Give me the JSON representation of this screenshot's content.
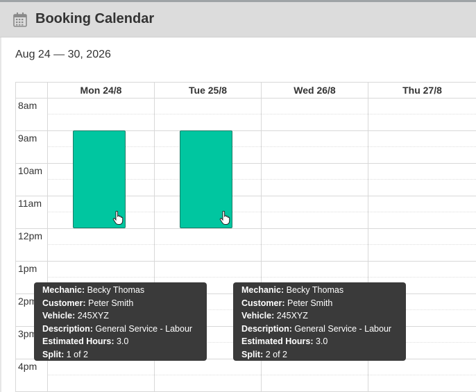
{
  "header": {
    "title": "Booking Calendar",
    "icon": "calendar-icon"
  },
  "date_range": "Aug 24 — 30, 2026",
  "days": [
    "Mon 24/8",
    "Tue 25/8",
    "Wed 26/8",
    "Thu 27/8"
  ],
  "times": [
    "8am",
    "9am",
    "10am",
    "11am",
    "12pm",
    "1pm",
    "2pm",
    "3pm",
    "4pm"
  ],
  "colors": {
    "event": "#00c6a0",
    "tooltip_bg": "#3a3a3a",
    "header_bg": "#dcdcdc"
  },
  "events": [
    {
      "day": "Mon 24/8",
      "start": "9am",
      "end": "12pm"
    },
    {
      "day": "Tue 25/8",
      "start": "9am",
      "end": "12pm"
    }
  ],
  "tooltips": [
    {
      "labels": {
        "mechanic": "Mechanic:",
        "customer": "Customer:",
        "vehicle": "Vehicle:",
        "description": "Description:",
        "hours": "Estimated Hours:",
        "split": "Split:"
      },
      "mechanic": "Becky Thomas",
      "customer": "Peter Smith",
      "vehicle": "245XYZ",
      "description": "General Service - Labour",
      "hours": "3.0",
      "split": "1 of 2"
    },
    {
      "labels": {
        "mechanic": "Mechanic:",
        "customer": "Customer:",
        "vehicle": "Vehicle:",
        "description": "Description:",
        "hours": "Estimated Hours:",
        "split": "Split:"
      },
      "mechanic": "Becky Thomas",
      "customer": "Peter Smith",
      "vehicle": "245XYZ",
      "description": "General Service - Labour",
      "hours": "3.0",
      "split": "2 of 2"
    }
  ]
}
